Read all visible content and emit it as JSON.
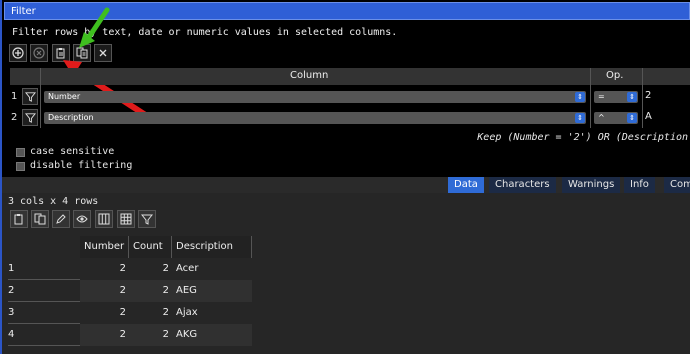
{
  "window": {
    "title": "Filter"
  },
  "description": "Filter rows by text, date or numeric values in selected columns.",
  "toolbar": {
    "buttons": [
      {
        "name": "add-icon"
      },
      {
        "name": "remove-icon"
      },
      {
        "name": "paste-icon"
      },
      {
        "name": "copy-icon"
      },
      {
        "name": "close-icon"
      }
    ]
  },
  "filter_table": {
    "headers": {
      "column": "Column",
      "op": "Op."
    },
    "rows": [
      {
        "index": "1",
        "column": "Number",
        "op": "=",
        "value": "2"
      },
      {
        "index": "2",
        "column": "Description",
        "op": "^",
        "value": "A"
      }
    ]
  },
  "expression": "Keep (Number = '2') OR (Description",
  "options": {
    "case_sensitive": "case sensitive",
    "disable_filtering": "disable filtering"
  },
  "tabs": [
    {
      "label": "Data",
      "active": true
    },
    {
      "label": "Characters",
      "active": false
    },
    {
      "label": "Warnings",
      "active": false
    },
    {
      "label": "Info",
      "active": false
    },
    {
      "label": "Comm",
      "active": false
    }
  ],
  "data_view": {
    "dimensions": "3 cols x 4 rows",
    "columns": [
      "Number",
      "Count",
      "Description"
    ],
    "rows": [
      {
        "index": "1",
        "number": "2",
        "count": "2",
        "description": "Acer"
      },
      {
        "index": "2",
        "number": "2",
        "count": "2",
        "description": "AEG"
      },
      {
        "index": "3",
        "number": "2",
        "count": "2",
        "description": "Ajax"
      },
      {
        "index": "4",
        "number": "2",
        "count": "2",
        "description": "AKG"
      }
    ]
  },
  "annotations": {
    "green_arrow_color": "#3fbf1f",
    "red_arrow_color": "#e01b1b"
  }
}
